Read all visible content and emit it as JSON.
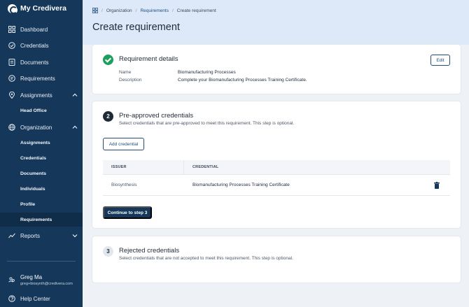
{
  "app": {
    "name": "My Credivera"
  },
  "sidebar": {
    "items": [
      {
        "label": "Dashboard",
        "icon": "grid-icon"
      },
      {
        "label": "Credentials",
        "icon": "badge-check-icon"
      },
      {
        "label": "Documents",
        "icon": "document-icon"
      },
      {
        "label": "Requirements",
        "icon": "requirements-icon"
      },
      {
        "label": "Assignments",
        "icon": "pin-icon",
        "expanded": true
      },
      {
        "label": "Organization",
        "icon": "globe-icon",
        "expanded": true
      },
      {
        "label": "Reports",
        "icon": "chart-line-icon",
        "expanded": false
      }
    ],
    "assignments_sub": [
      "Head Office"
    ],
    "organization_sub": [
      "Assignments",
      "Credentials",
      "Documents",
      "Individuals",
      "Profile",
      "Requirements"
    ],
    "active_sub": "Requirements",
    "user": {
      "name": "Greg Ma",
      "email": "greg+biosynth@credivera.com"
    },
    "help": "Help Center"
  },
  "breadcrumb": {
    "items": [
      "Organization",
      "Requirements",
      "Create requirement"
    ]
  },
  "page": {
    "title": "Create requirement"
  },
  "details": {
    "title": "Requirement details",
    "edit_label": "Edit",
    "name_label": "Name",
    "name_value": "Biomanufacturing Processes",
    "description_label": "Description",
    "description_value": "Complete your Biomanufacturing Processes Training Certificate."
  },
  "preapproved": {
    "step": "2",
    "title": "Pre-approved credentials",
    "subtitle": "Select credentials that are pre-approved to meet this requirement. This step is optional.",
    "add_label": "Add credential",
    "columns": [
      "ISSUER",
      "CREDENTIAL"
    ],
    "rows": [
      {
        "issuer": "Biosynthesis",
        "credential": "Biomanufacturing Processes Training Certificate"
      }
    ],
    "continue_label": "Continue to step 3"
  },
  "rejected": {
    "step": "3",
    "title": "Rejected credentials",
    "subtitle": "Select credentials that are not accepted to meet this requirement. This step is optional."
  },
  "colors": {
    "sidebar": "#14375a",
    "accent": "#1d4f7e",
    "success": "#1e9e5f",
    "header_band": "#dde8f8"
  }
}
